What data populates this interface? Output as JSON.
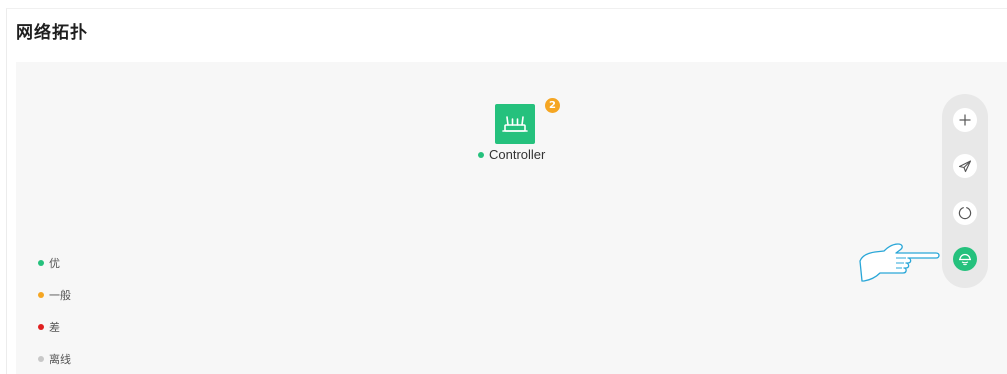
{
  "page": {
    "title": "网络拓扑"
  },
  "topology": {
    "device": {
      "name": "Controller",
      "badge_count": "2",
      "status_color": "#25c17d",
      "icon": "router-icon"
    }
  },
  "legend": {
    "items": [
      {
        "label": "优",
        "color": "#25c17d"
      },
      {
        "label": "一般",
        "color": "#f5a623"
      },
      {
        "label": "差",
        "color": "#e02020"
      },
      {
        "label": "离线",
        "color": "#c8c8c8"
      }
    ]
  },
  "toolbar": {
    "buttons": [
      {
        "icon": "plus-icon",
        "active": false
      },
      {
        "icon": "send-icon",
        "active": false
      },
      {
        "icon": "refresh-icon",
        "active": false
      },
      {
        "icon": "wireless-icon",
        "active": true
      }
    ]
  },
  "colors": {
    "accent": "#25c17d",
    "badge": "#f5a623",
    "pointer_outline": "#2aa7d8"
  }
}
